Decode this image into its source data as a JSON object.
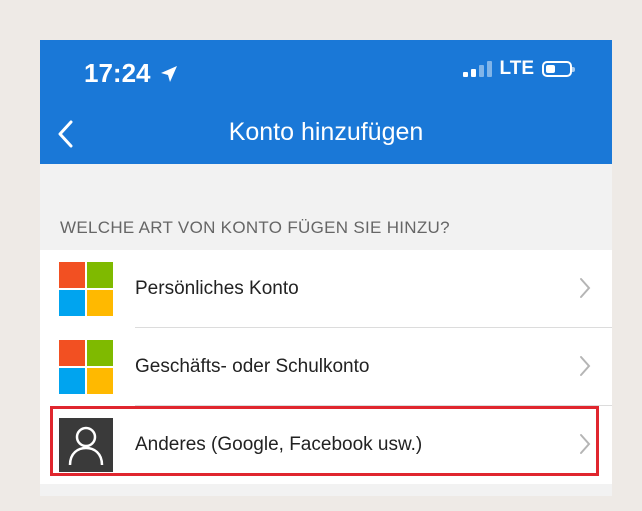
{
  "status_bar": {
    "time": "17:24",
    "network": "LTE"
  },
  "nav": {
    "title": "Konto hinzufügen"
  },
  "section": {
    "header": "WELCHE ART VON KONTO FÜGEN SIE HINZU?"
  },
  "accounts": [
    {
      "label": "Persönliches Konto",
      "icon": "microsoft-logo-icon"
    },
    {
      "label": "Geschäfts- oder Schulkonto",
      "icon": "microsoft-logo-icon"
    },
    {
      "label": "Anderes (Google, Facebook usw.)",
      "icon": "person-icon"
    }
  ],
  "colors": {
    "header_blue": "#1a78d7",
    "ms_red": "#f25022",
    "ms_green": "#7fba00",
    "ms_blue": "#00a4ef",
    "ms_yellow": "#ffb900",
    "highlight_red": "#e0262e"
  }
}
